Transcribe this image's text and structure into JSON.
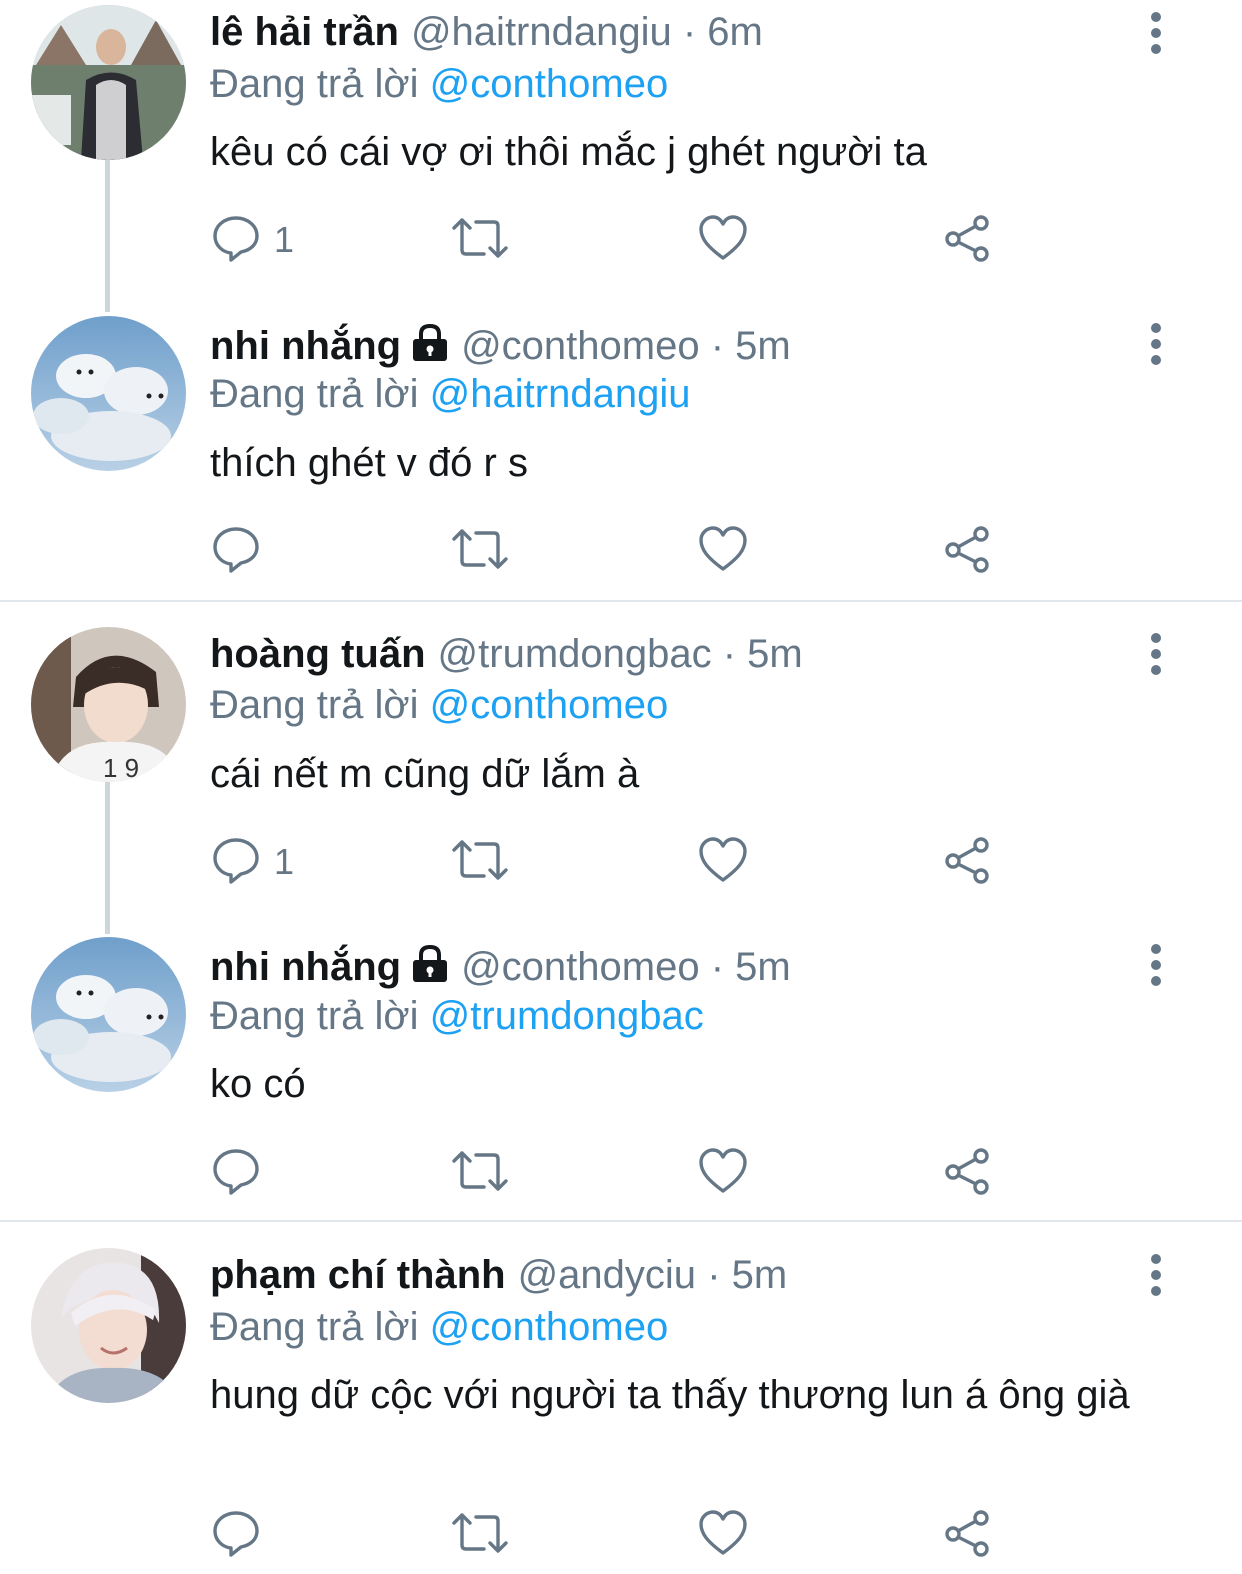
{
  "reply_prefix": "Đang trả lời",
  "colors": {
    "link": "#1da1f2",
    "muted": "#657786",
    "text": "#14171a",
    "divider": "#e1e8ed"
  },
  "tweets": [
    {
      "name": "lê hải trần",
      "handle": "@haitrndangiu",
      "time": "· 6m",
      "locked": false,
      "reply_to": "@conthomeo",
      "text": "kêu có cái vợ ơi thôi mắc j ghét người ta",
      "reply_count": "1",
      "avatar": "photo-person-hoodie"
    },
    {
      "name": "nhi nhắng",
      "handle": "@conthomeo",
      "time": "· 5m",
      "locked": true,
      "reply_to": "@haitrndangiu",
      "text": "thích ghét v đó r s",
      "reply_count": "",
      "avatar": "cloud-sky"
    },
    {
      "name": "hoàng tuấn",
      "handle": "@trumdongbac",
      "time": "· 5m",
      "locked": false,
      "reply_to": "@conthomeo",
      "text": "cái nết m cũng dữ lắm à",
      "reply_count": "1",
      "avatar": "photo-person-white-shirt"
    },
    {
      "name": "nhi nhắng",
      "handle": "@conthomeo",
      "time": "· 5m",
      "locked": true,
      "reply_to": "@trumdongbac",
      "text": "ko có",
      "reply_count": "",
      "avatar": "cloud-sky"
    },
    {
      "name": "phạm chí thành",
      "handle": "@andyciu",
      "time": "· 5m",
      "locked": false,
      "reply_to": "@conthomeo",
      "text": "hung dữ cộc với người ta thấy thương lun á ông già",
      "reply_count": "",
      "avatar": "photo-person-white-hair"
    }
  ],
  "icons": {
    "reply": "reply-icon",
    "retweet": "retweet-icon",
    "like": "heart-icon",
    "share": "share-icon",
    "more": "more-vertical-icon",
    "lock": "lock-icon"
  }
}
